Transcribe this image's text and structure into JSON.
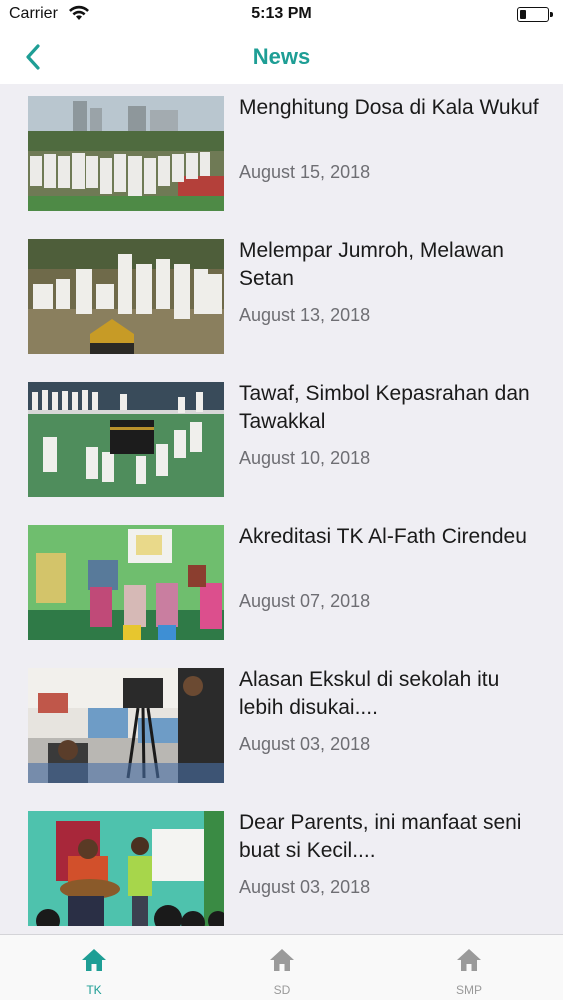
{
  "status_bar": {
    "carrier": "Carrier",
    "time": "5:13 PM"
  },
  "nav": {
    "title": "News",
    "back_icon": "chevron-left-icon",
    "accent_color": "#1e9e95"
  },
  "news": [
    {
      "title": "Menghitung Dosa di Kala Wukuf",
      "date": "August 15, 2018",
      "thumbnail": "photo of students in white pilgrim clothing outdoors"
    },
    {
      "title": "Melempar Jumroh, Melawan Setan",
      "date": "August 13, 2018",
      "thumbnail": "photo of children in white throwing pebbles"
    },
    {
      "title": "Tawaf, Simbol Kepasrahan dan Tawakkal",
      "date": "August 10, 2018",
      "thumbnail": "photo of children circling a Kaaba replica"
    },
    {
      "title": "Akreditasi TK Al-Fath Cirendeu",
      "date": "August 07, 2018",
      "thumbnail": "photo of classroom with teachers"
    },
    {
      "title": "Alasan Ekskul di sekolah itu lebih disukai....",
      "date": "August 03, 2018",
      "thumbnail": "photo of camera crew filming in classroom"
    },
    {
      "title": "Dear Parents, ini manfaat seni buat si Kecil....",
      "date": "August 03, 2018",
      "thumbnail": "photo of child singing with guitarist"
    }
  ],
  "tabs": [
    {
      "label": "TK",
      "icon": "home-icon",
      "active": true
    },
    {
      "label": "SD",
      "icon": "home-icon",
      "active": false
    },
    {
      "label": "SMP",
      "icon": "home-icon",
      "active": false
    }
  ]
}
